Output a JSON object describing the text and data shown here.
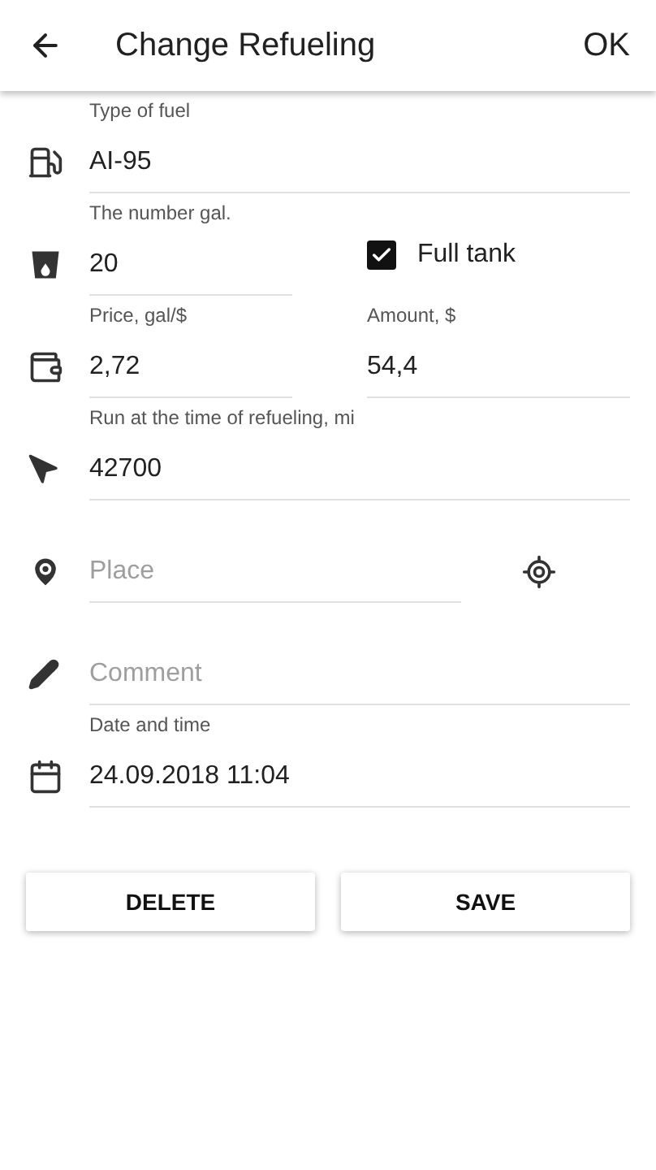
{
  "header": {
    "title": "Change Refueling",
    "action": "OK"
  },
  "fuel_type": {
    "label": "Type of fuel",
    "value": "AI-95"
  },
  "volume": {
    "label": "The number gal.",
    "value": "20"
  },
  "full_tank": {
    "label": "Full tank",
    "checked": true
  },
  "price": {
    "label": "Price, gal/$",
    "value": "2,72"
  },
  "amount": {
    "label": "Amount, $",
    "value": "54,4"
  },
  "mileage": {
    "label": "Run at the time of refueling, mi",
    "value": "42700"
  },
  "place": {
    "placeholder": "Place"
  },
  "comment": {
    "placeholder": "Comment"
  },
  "date_time": {
    "label": "Date and time",
    "value": "24.09.2018 11:04"
  },
  "buttons": [
    "DELETE",
    "SAVE"
  ]
}
